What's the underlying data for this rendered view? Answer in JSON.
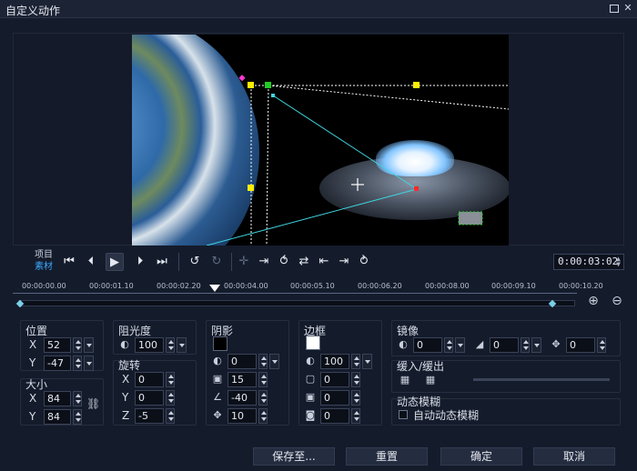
{
  "window": {
    "title": "自定义动作"
  },
  "controls": {
    "mode_project": "项目",
    "mode_clip": "素材",
    "timecode": "0:00:03:02"
  },
  "ruler": {
    "ticks": [
      "00:00:00.00",
      "00:00:01.10",
      "00:00:02.20",
      "00:00:04.00",
      "00:00:05.10",
      "00:00:06.20",
      "00:00:08.00",
      "00:00:09.10",
      "00:00:10.20"
    ]
  },
  "position": {
    "label": "位置",
    "x_label": "X",
    "x": "52",
    "y_label": "Y",
    "y": "-47"
  },
  "size": {
    "label": "大小",
    "x_label": "X",
    "x": "84",
    "y_label": "Y",
    "y": "84"
  },
  "opacity": {
    "label": "阻光度",
    "value": "100"
  },
  "rotation": {
    "label": "旋转",
    "x_label": "X",
    "x": "0",
    "y_label": "Y",
    "y": "0",
    "z_label": "Z",
    "z": "-5"
  },
  "shadow": {
    "label": "阴影",
    "opacity": "0",
    "blur": "15",
    "angle": "-40",
    "distance": "10",
    "color": "#000000"
  },
  "border": {
    "label": "边框",
    "opacity": "100",
    "width": "0",
    "blur": "0",
    "corner": "0",
    "color": "#ffffff"
  },
  "mirror": {
    "label": "镜像",
    "opacity": "0",
    "fade": "0",
    "offset": "0"
  },
  "ease": {
    "label": "缓入/缓出"
  },
  "motion_blur": {
    "label": "动态模糊",
    "auto_label": "自动动态模糊"
  },
  "buttons": {
    "save_to": "保存至...",
    "reset": "重置",
    "ok": "确定",
    "cancel": "取消"
  }
}
